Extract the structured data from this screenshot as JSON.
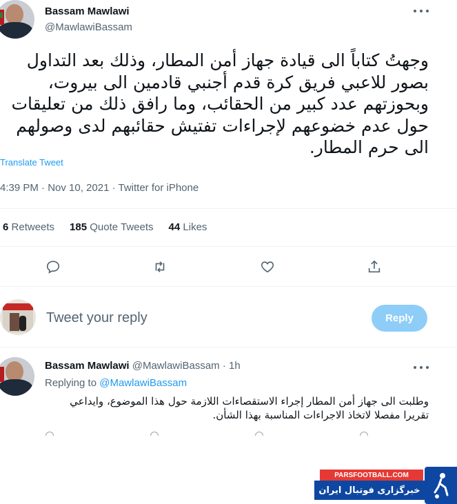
{
  "tweet": {
    "author_name": "Bassam Mawlawi",
    "author_handle": "@MawlawiBassam",
    "text": "وجهتُ كتاباً الى قيادة جهاز أمن المطار، وذلك بعد التداول بصور للاعبي فريق كرة قدم أجنبي قادمين الى بيروت، وبحوزتهم عدد كبير من الحقائب، وما رافق ذلك من تعليقات حول عدم خضوعهم لإجراءات تفتيش حقائبهم لدى وصولهم الى حرم المطار.",
    "translate_label": "Translate Tweet",
    "meta": "4:39 PM · Nov 10, 2021 · Twitter for iPhone",
    "stats": {
      "retweets_count": "6",
      "retweets_label": "Retweets",
      "quotes_count": "185",
      "quotes_label": "Quote Tweets",
      "likes_count": "44",
      "likes_label": "Likes"
    },
    "actions": [
      "reply-icon",
      "retweet-icon",
      "like-icon",
      "share-icon"
    ]
  },
  "composer": {
    "placeholder": "Tweet your reply",
    "reply_button": "Reply"
  },
  "reply_tweet": {
    "author_name": "Bassam Mawlawi",
    "meta": "@MawlawiBassam · 1h",
    "replying_prefix": "Replying to",
    "replying_to": "@MawlawiBassam",
    "text": "وطلبت الى جهاز أمن المطار إجراء الاستقصاءات اللازمة حول هذا الموضوع، وايداعي تقريرا مفصلا لاتخاذ الاجراءات المناسبة بهذا الشأن."
  },
  "watermark": {
    "site": "PARSFOOTBALL.COM",
    "tagline": "خبرگزاری فوتبال ایران"
  },
  "colors": {
    "accent": "#1d9bf0",
    "reply_button_disabled": "#8ecdf8",
    "secondary_text": "#536471"
  }
}
